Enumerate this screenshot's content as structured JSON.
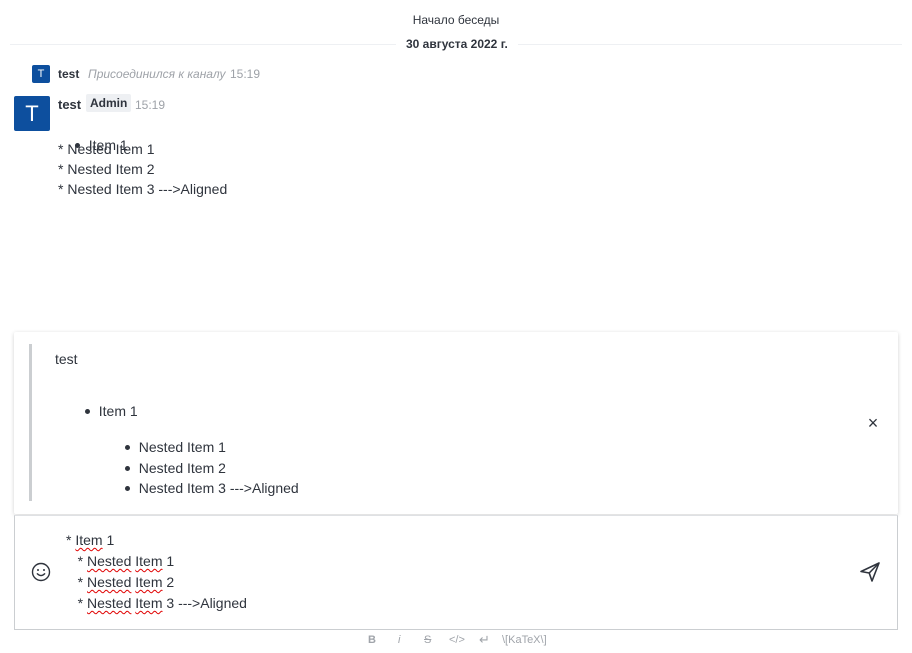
{
  "header": {
    "start_label": "Начало беседы",
    "date": "30 августа 2022 г."
  },
  "system_message": {
    "avatar_letter": "T",
    "user": "test",
    "text": "Присоединился к каналу",
    "time": "15:19"
  },
  "message": {
    "avatar_letter": "T",
    "user": "test",
    "badge": "Admin",
    "time": "15:19",
    "lines": [
      "Item 1",
      "* Nested Item 1",
      "* Nested Item 2",
      "* Nested Item 3 --->Aligned"
    ]
  },
  "quote": {
    "author": "test",
    "item": "Item 1",
    "nested": [
      "Nested Item 1",
      "Nested Item 2",
      "Nested Item 3 --->Aligned"
    ],
    "close_icon": "×"
  },
  "composer": {
    "lines": [
      {
        "prefix": "* ",
        "word": "Item",
        "rest": " 1"
      },
      {
        "prefix": "   * ",
        "word": "Nested",
        "word2": "Item",
        "rest": " 1"
      },
      {
        "prefix": "   * ",
        "word": "Nested",
        "word2": "Item",
        "rest": " 2"
      },
      {
        "prefix": "   * ",
        "word": "Nested",
        "word2": "Item",
        "rest": " 3 --->Aligned"
      }
    ]
  },
  "toolbar": {
    "bold": "B",
    "italic": "i",
    "strike": "S",
    "code": "</>",
    "multiline": "↵",
    "katex": "\\[KaTeX\\]"
  },
  "colors": {
    "accent": "#0d4f9e",
    "text": "#2f343d",
    "muted": "#9ea2a8"
  }
}
